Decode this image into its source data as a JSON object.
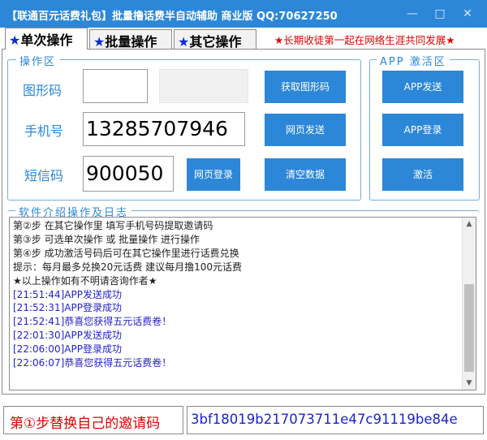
{
  "window": {
    "title": "【联通百元话费礼包】批量撸话费半自动辅助 商业版 QQ:70627250",
    "minimize_glyph": "—",
    "maximize_glyph": "□",
    "close_glyph": "✕"
  },
  "tabs": [
    {
      "star": "★",
      "label": "单次操作",
      "active": true
    },
    {
      "star": "★",
      "label": "批量操作",
      "active": false
    },
    {
      "star": "★",
      "label": "其它操作",
      "active": false
    }
  ],
  "marquee": "★长期收徒第一起在网络生涯共同发展★",
  "operation_area": {
    "title": "操作区",
    "captcha_label": "图形码",
    "captcha_value": "",
    "phone_label": "手机号",
    "phone_value": "13285707946",
    "sms_label": "短信码",
    "sms_value": "900050",
    "get_captcha_button": "获取图形码",
    "web_send_button": "网页发送",
    "web_login_button": "网页登录",
    "clear_button": "清空数据"
  },
  "app_area": {
    "title": "APP 激活区",
    "app_send_button": "APP发送",
    "app_login_button": "APP登录",
    "activate_button": "激活"
  },
  "log_area": {
    "title": "软件介绍操作及日志",
    "lines": [
      "第②步 在其它操作里 填写手机号码提取邀请码",
      "第③步 可选单次操作 或 批量操作 进行操作",
      "第④步 成功激活号码后可在其它操作里进行话费兑换",
      "提示：每月最多兑换20元话费 建议每月撸100元话费",
      "★以上操作如有不明请咨询作者★",
      "[21:51:44]APP发送成功",
      "[21:52:31]APP登录成功",
      "[21:52:41]恭喜您获得五元话费卷！",
      "[22:01:30]APP发送成功",
      "[22:06:00]APP登录成功",
      "[22:06:07]恭喜您获得五元话费卷！"
    ]
  },
  "footer": {
    "invite_hint": "第①步替换自己的邀请码",
    "invite_code": "3bf18019b217073711e47c91119be84e"
  },
  "colors": {
    "title_bar": "#2c87d8",
    "button": "#2c87d8",
    "group_border": "#76aedb",
    "accent_red": "#e00000",
    "log_text": "#2222cc"
  }
}
